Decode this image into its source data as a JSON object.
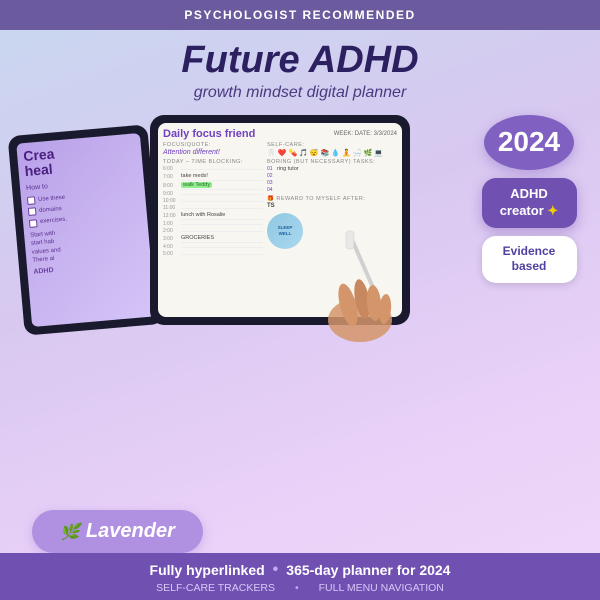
{
  "topBanner": {
    "text": "PSYCHOLOGIST RECOMMENDED"
  },
  "title": {
    "line1": "Future ADHD",
    "line2": "growth mindset digital planner"
  },
  "tabletLeft": {
    "title1": "Crea",
    "title2": "hea",
    "howTo": "How to",
    "bullets": [
      "Use these",
      "domains",
      "exercises.",
      "Start with",
      "start hab",
      "values and",
      "There al"
    ],
    "bottomLabel": "ADHD"
  },
  "tabletMain": {
    "plannerTitle": "Daily focus friend",
    "week": "WEEK:",
    "date": "DATE: 3/3/2024",
    "focusLabel": "FOCUS/QUOTE:",
    "focusText": "Attention different!",
    "todayLabel": "TODAY – TIME BLOCKING:",
    "timeBlocks": [
      {
        "time": "6:00",
        "content": ""
      },
      {
        "time": "7:00",
        "content": "take meds!"
      },
      {
        "time": "8:00",
        "content": "walk Teddy",
        "highlight": true
      },
      {
        "time": "9:00",
        "content": ""
      },
      {
        "time": "10:00",
        "content": ""
      },
      {
        "time": "11:00",
        "content": ""
      },
      {
        "time": "12:00",
        "content": "lunch with Rosalie"
      },
      {
        "time": "1:00",
        "content": ""
      },
      {
        "time": "2:00",
        "content": ""
      },
      {
        "time": "3:00",
        "content": "GROCERIES"
      },
      {
        "time": "4:00",
        "content": ""
      },
      {
        "time": "5:00",
        "content": ""
      }
    ],
    "selfCareLabel": "SELF-CARE:",
    "icons": [
      "🦷",
      "❤️",
      "💊",
      "🎵",
      "😴",
      "📚",
      "💧",
      "🧘",
      "🛁",
      "🌿",
      "💻"
    ],
    "boringTasksLabel": "BORING (BUT NECESSARY) TASKS:",
    "tasks": [
      {
        "num": "01",
        "text": "ring tutor"
      },
      {
        "num": "02",
        "text": ""
      },
      {
        "num": "03",
        "text": ""
      },
      {
        "num": "04",
        "text": ""
      }
    ],
    "rewardLabel": "🎁 REWARD TO MYSELF AFTER:",
    "rewardText": "TS",
    "stickerText": "SLEEP WELL"
  },
  "badges": {
    "year": "2024",
    "sparkle": "✦",
    "adhdCreator": "ADHD\ncreator",
    "evidenceBased": "Evidence\nbased"
  },
  "lavenderBadge": {
    "icon": "🌿",
    "text": "Lavender"
  },
  "bottomBar": {
    "mainLeft": "Fully hyperlinked",
    "dot": "•",
    "mainRight": "365-day planner for 2024",
    "subLeft": "SELF-CARE TRACKERS",
    "separator": "•",
    "subRight": "FULL MENU NAVIGATION"
  }
}
